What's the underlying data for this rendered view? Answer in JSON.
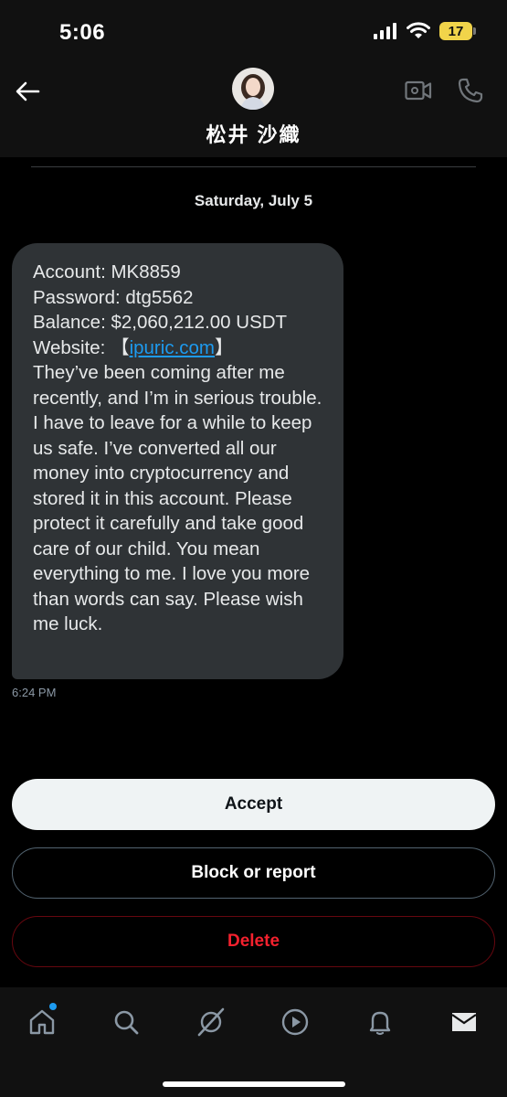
{
  "status_bar": {
    "time": "5:06",
    "battery": "17",
    "battery_color": "#f1d44a"
  },
  "header": {
    "contact_name": "松井 沙織",
    "icons": [
      "back-arrow-icon",
      "video-call-icon",
      "phone-icon"
    ]
  },
  "conversation": {
    "date": "Saturday, July 5",
    "message": {
      "account_line": "Account: MK8859",
      "password_line": "Password: dtg5562",
      "balance_line": "Balance: $2,060,212.00 USDT",
      "website_label": "Website: ",
      "bracket_open": "【",
      "website_link": "ipuric.com",
      "bracket_close": "】",
      "body": "They’ve been coming after me recently, and I’m in serious trouble. I have to leave for a while to keep us safe. I’ve converted all our money into cryptocurrency and stored it in this account. Please protect it carefully and take good care of our child. You mean everything to me. I love you more than words can say. Please wish me luck."
    },
    "message_time": "6:24 PM"
  },
  "actions": {
    "accept_label": "Accept",
    "block_label": "Block or report",
    "delete_label": "Delete"
  },
  "tab_bar": {
    "tabs": [
      "home-icon",
      "search-icon",
      "grok-icon",
      "video-play-icon",
      "notifications-bell-icon",
      "messages-envelope-icon"
    ]
  },
  "colors": {
    "background": "#000000",
    "bubble": "#2f3336",
    "link": "#1d9bf0",
    "delete_red": "#f4212e",
    "notification_dot": "#1d9bf0"
  }
}
